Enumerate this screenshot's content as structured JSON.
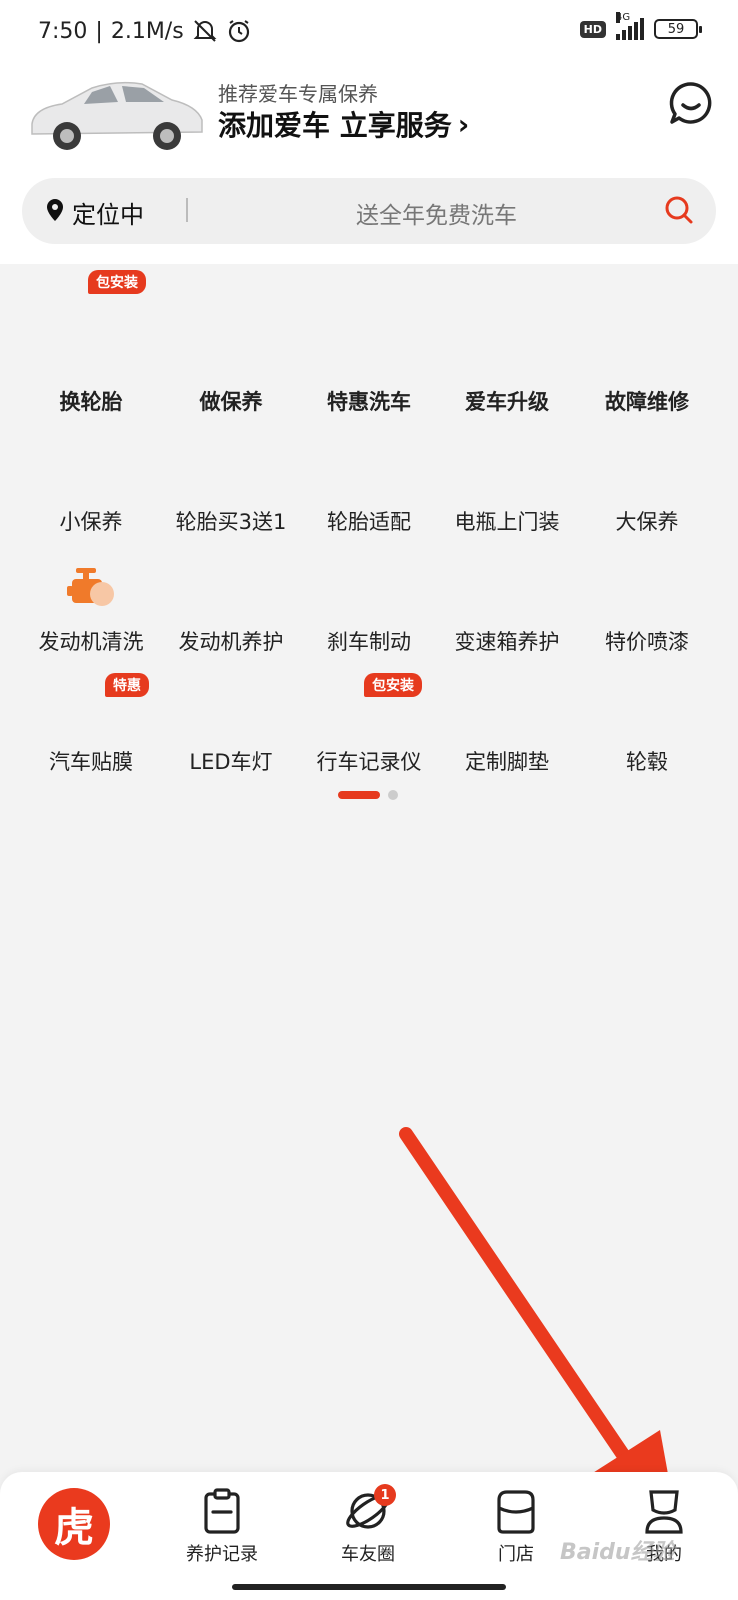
{
  "status_bar": {
    "time": "7:50",
    "network_speed": "2.1M/s",
    "hd_label": "HD",
    "net_type": "4G",
    "battery": "59"
  },
  "header": {
    "promo_subtitle": "推荐爱车专属保养",
    "promo_title": "添加爱车 立享服务",
    "promo_chevron": "›"
  },
  "search": {
    "location": "定位中",
    "placeholder": "送全年免费洗车"
  },
  "services": {
    "row1": [
      {
        "label": "换轮胎",
        "badge": "包安装"
      },
      {
        "label": "做保养"
      },
      {
        "label": "特惠洗车"
      },
      {
        "label": "爱车升级"
      },
      {
        "label": "故障维修"
      }
    ],
    "row2": [
      {
        "label": "小保养"
      },
      {
        "label": "轮胎买3送1"
      },
      {
        "label": "轮胎适配"
      },
      {
        "label": "电瓶上门装"
      },
      {
        "label": "大保养"
      }
    ],
    "row3": [
      {
        "label": "发动机清洗"
      },
      {
        "label": "发动机养护"
      },
      {
        "label": "刹车制动"
      },
      {
        "label": "变速箱养护"
      },
      {
        "label": "特价喷漆"
      }
    ],
    "row4": [
      {
        "label": "汽车贴膜",
        "badge": "特惠"
      },
      {
        "label": "LED车灯"
      },
      {
        "label": "行车记录仪",
        "badge": "包安装"
      },
      {
        "label": "定制脚垫"
      },
      {
        "label": "轮毂"
      }
    ]
  },
  "tabbar": {
    "home_logo": "虎",
    "tabs": [
      {
        "label": "养护记录"
      },
      {
        "label": "车友圈",
        "notification": "1"
      },
      {
        "label": "门店"
      },
      {
        "label": "我的"
      }
    ]
  },
  "watermark": "Baidu经验",
  "colors": {
    "accent": "#e63a1e",
    "background": "#f3f3f3"
  }
}
